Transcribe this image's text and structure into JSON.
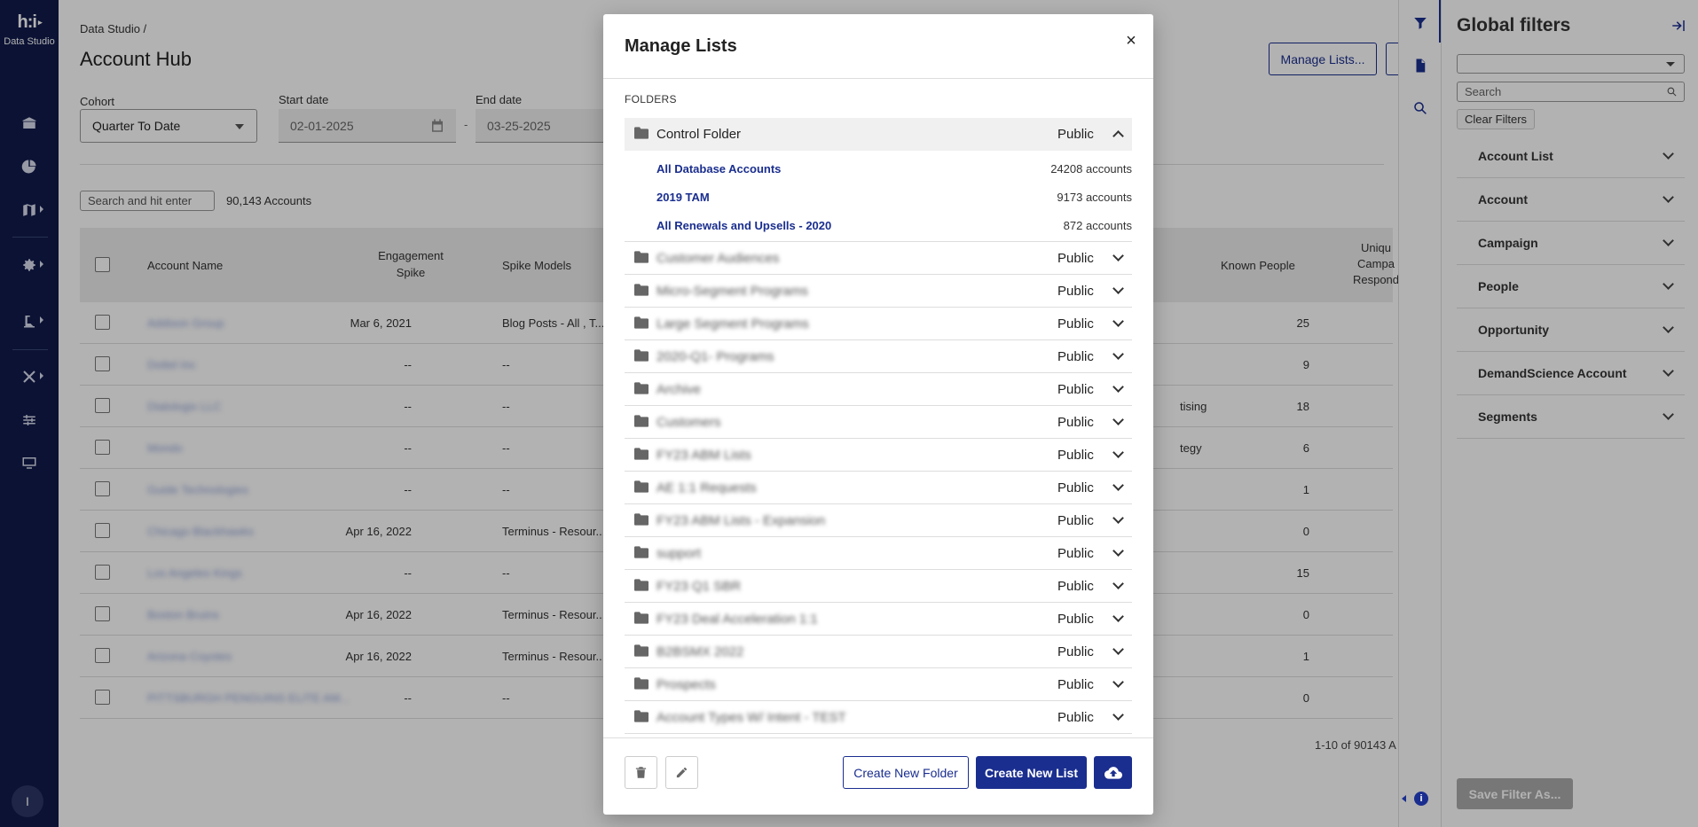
{
  "nav": {
    "logo_mark": "h:i",
    "logo_text": "Data Studio",
    "avatar_initial": "I"
  },
  "header": {
    "breadcrumb": "Data Studio /",
    "title": "Account Hub",
    "manage_lists_label": "Manage Lists..."
  },
  "filters_bar": {
    "cohort_label": "Cohort",
    "cohort_value": "Quarter To Date",
    "start_label": "Start date",
    "start_value": "02-01-2025",
    "end_label": "End date",
    "end_value": "03-25-2025",
    "date_separator": "-"
  },
  "table": {
    "search_placeholder": "Search and hit enter",
    "account_count": "90,143 Accounts",
    "headers": {
      "account_name": "Account Name",
      "engagement_spike_1": "Engagement",
      "engagement_spike_2": "Spike",
      "spike_models": "Spike Models",
      "known_people": "Known People",
      "unique_1": "Uniqu",
      "unique_2": "Campa",
      "unique_3": "Respond"
    },
    "rows": [
      {
        "name": "Addison Group",
        "spike": "Mar 6, 2021",
        "model": "Blog Posts - All , T...",
        "extra": "",
        "known": "25"
      },
      {
        "name": "Dottel Inc",
        "spike": "--",
        "model": "--",
        "extra": "",
        "known": "9"
      },
      {
        "name": "Dialologix LLC",
        "spike": "--",
        "model": "--",
        "extra": "tising",
        "known": "18"
      },
      {
        "name": "Mondo",
        "spike": "--",
        "model": "--",
        "extra": "tegy",
        "known": "6"
      },
      {
        "name": "Guide Technologies",
        "spike": "--",
        "model": "--",
        "extra": "",
        "known": "1"
      },
      {
        "name": "Chicago Blackhawks",
        "spike": "Apr 16, 2022",
        "model": "Terminus - Resour...",
        "extra": "",
        "known": "0"
      },
      {
        "name": "Los Angeles Kings",
        "spike": "--",
        "model": "--",
        "extra": "",
        "known": "15"
      },
      {
        "name": "Boston Bruins",
        "spike": "Apr 16, 2022",
        "model": "Terminus - Resour...",
        "extra": "",
        "known": "0"
      },
      {
        "name": "Arizona Coyotes",
        "spike": "Apr 16, 2022",
        "model": "Terminus - Resour...",
        "extra": "",
        "known": "1"
      },
      {
        "name": "PITTSBURGH PENGUINS ELITE AM...",
        "spike": "--",
        "model": "--",
        "extra": "",
        "known": "0"
      }
    ],
    "pagination": "1-10 of 90143 A"
  },
  "modal": {
    "title": "Manage Lists",
    "close_label": "×",
    "folders_label": "FOLDERS",
    "open_folder": {
      "name": "Control Folder",
      "visibility": "Public",
      "lists": [
        {
          "name": "All Database Accounts",
          "count": "24208 accounts"
        },
        {
          "name": "2019 TAM",
          "count": "9173 accounts"
        },
        {
          "name": "All Renewals and Upsells - 2020",
          "count": "872 accounts"
        }
      ]
    },
    "folders": [
      {
        "name": "Customer Audiences",
        "visibility": "Public"
      },
      {
        "name": "Micro-Segment Programs",
        "visibility": "Public"
      },
      {
        "name": "Large Segment Programs",
        "visibility": "Public"
      },
      {
        "name": "2020-Q1- Programs",
        "visibility": "Public"
      },
      {
        "name": "Archive",
        "visibility": "Public"
      },
      {
        "name": "Customers",
        "visibility": "Public"
      },
      {
        "name": "FY23 ABM Lists",
        "visibility": "Public"
      },
      {
        "name": "AE 1:1 Requests",
        "visibility": "Public"
      },
      {
        "name": "FY23 ABM Lists - Expansion",
        "visibility": "Public"
      },
      {
        "name": "support",
        "visibility": "Public"
      },
      {
        "name": "FY23 Q1 SBR",
        "visibility": "Public"
      },
      {
        "name": "FY23 Deal Acceleration 1:1",
        "visibility": "Public"
      },
      {
        "name": "B2BSMX 2022",
        "visibility": "Public"
      },
      {
        "name": "Prospects",
        "visibility": "Public"
      },
      {
        "name": "Account Types W/ Intent - TEST",
        "visibility": "Public"
      }
    ],
    "create_folder_label": "Create New Folder",
    "create_list_label": "Create New List"
  },
  "global_filters": {
    "title": "Global filters",
    "search_placeholder": "Search",
    "clear_label": "Clear Filters",
    "items": [
      "Account List",
      "Account",
      "Campaign",
      "People",
      "Opportunity",
      "DemandScience Account",
      "Segments"
    ],
    "save_label": "Save Filter As..."
  },
  "colors": {
    "nav_bg": "#101a4b",
    "accent": "#1a2e8f",
    "link": "#1a2e8f"
  }
}
